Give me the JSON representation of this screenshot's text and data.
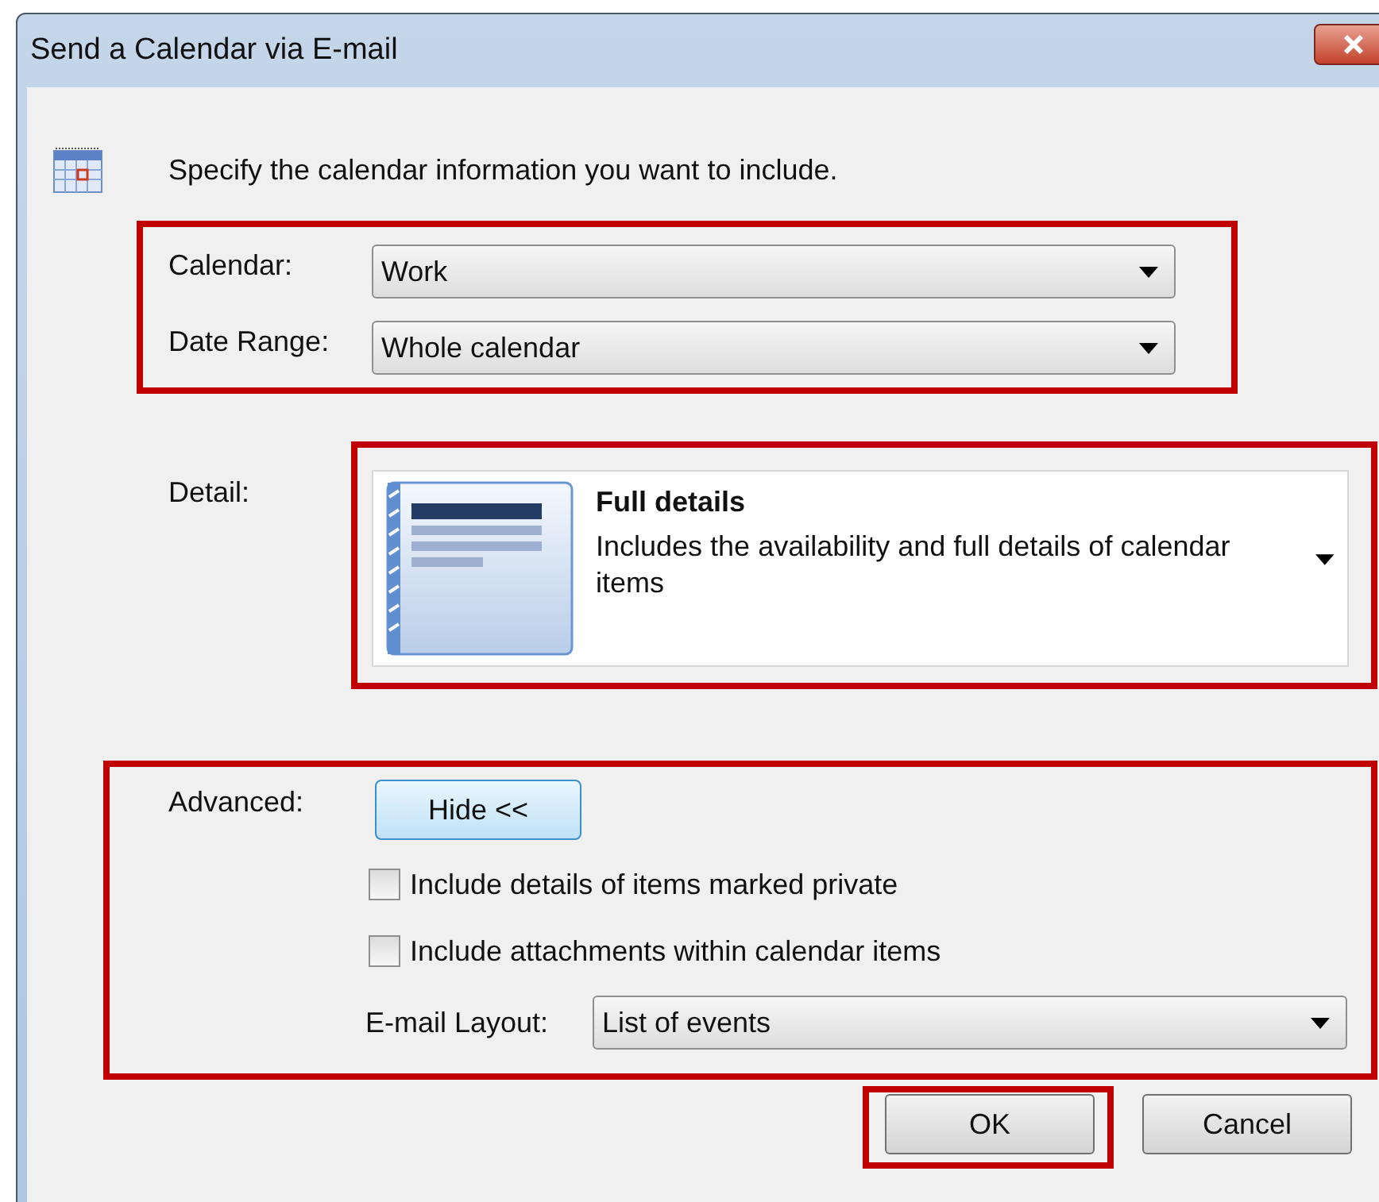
{
  "window": {
    "title": "Send a Calendar via E-mail"
  },
  "intro": "Specify the calendar information you want to include.",
  "selection": {
    "highlighted": true,
    "fields": [
      {
        "label": "Calendar:",
        "value": "Work"
      },
      {
        "label": "Date Range:",
        "value": "Whole calendar"
      }
    ]
  },
  "detail": {
    "label": "Detail:",
    "highlighted": true,
    "title": "Full details",
    "description": "Includes the availability and full details of calendar items"
  },
  "advanced": {
    "label": "Advanced:",
    "highlighted": true,
    "toggle_button": "Hide <<",
    "options": [
      {
        "label": "Include details of items marked private",
        "checked": false
      },
      {
        "label": "Include attachments within calendar items",
        "checked": false
      }
    ],
    "email_layout": {
      "label": "E-mail Layout:",
      "value": "List of events"
    }
  },
  "buttons": [
    {
      "label": "OK",
      "highlighted": true
    },
    {
      "label": "Cancel",
      "highlighted": false
    }
  ]
}
